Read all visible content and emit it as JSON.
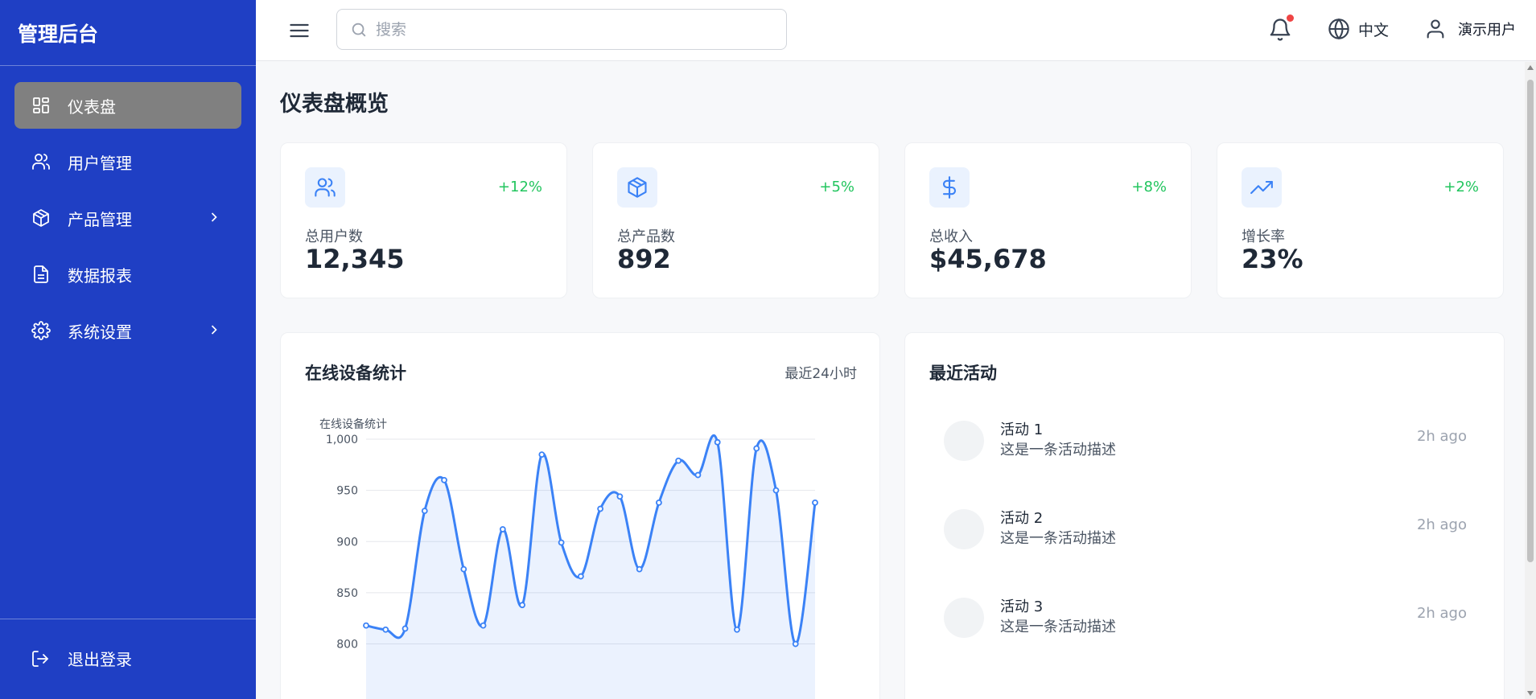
{
  "brand": {
    "title": "管理后台"
  },
  "sidebar": {
    "items": [
      {
        "label": "仪表盘",
        "icon": "dashboard-icon",
        "active": true
      },
      {
        "label": "用户管理",
        "icon": "users-icon"
      },
      {
        "label": "产品管理",
        "icon": "package-icon",
        "has_submenu": true
      },
      {
        "label": "数据报表",
        "icon": "document-icon"
      },
      {
        "label": "系统设置",
        "icon": "gear-icon",
        "has_submenu": true
      }
    ],
    "logout_label": "退出登录"
  },
  "header": {
    "search_placeholder": "搜索",
    "language": "中文",
    "user": "演示用户",
    "has_notification": true
  },
  "page": {
    "title": "仪表盘概览"
  },
  "stats": [
    {
      "label": "总用户数",
      "value": "12,345",
      "change": "+12%",
      "icon": "users-icon"
    },
    {
      "label": "总产品数",
      "value": "892",
      "change": "+5%",
      "icon": "package-icon"
    },
    {
      "label": "总收入",
      "value": "$45,678",
      "change": "+8%",
      "icon": "dollar-icon"
    },
    {
      "label": "增长率",
      "value": "23%",
      "change": "+2%",
      "icon": "trending-up-icon"
    }
  ],
  "device_panel": {
    "title": "在线设备统计",
    "subtitle": "最近24小时"
  },
  "activity_panel": {
    "title": "最近活动",
    "items": [
      {
        "title": "活动 1",
        "desc": "这是一条活动描述",
        "time": "2h ago"
      },
      {
        "title": "活动 2",
        "desc": "这是一条活动描述",
        "time": "2h ago"
      },
      {
        "title": "活动 3",
        "desc": "这是一条活动描述",
        "time": "2h ago"
      }
    ]
  },
  "colors": {
    "sidebar": "#1f3fc4",
    "accent": "#3b82f6",
    "positive": "#22c55e",
    "active_item": "#808080"
  },
  "chart_data": {
    "type": "area",
    "title": "在线设备统计",
    "ylim": [
      780,
      1000
    ],
    "yticks": [
      800,
      850,
      900,
      950,
      1000
    ],
    "ytick_labels": [
      "800",
      "850",
      "900",
      "950",
      "1,000"
    ],
    "grid": true,
    "x": [
      0,
      1,
      2,
      3,
      4,
      5,
      6,
      7,
      8,
      9,
      10,
      11,
      12,
      13,
      14,
      15,
      16,
      17,
      18,
      19,
      20,
      21,
      22,
      23
    ],
    "values": [
      818,
      814,
      815,
      930,
      960,
      873,
      818,
      912,
      838,
      985,
      899,
      866,
      932,
      944,
      873,
      938,
      979,
      965,
      997,
      814,
      991,
      950,
      800,
      938
    ]
  }
}
